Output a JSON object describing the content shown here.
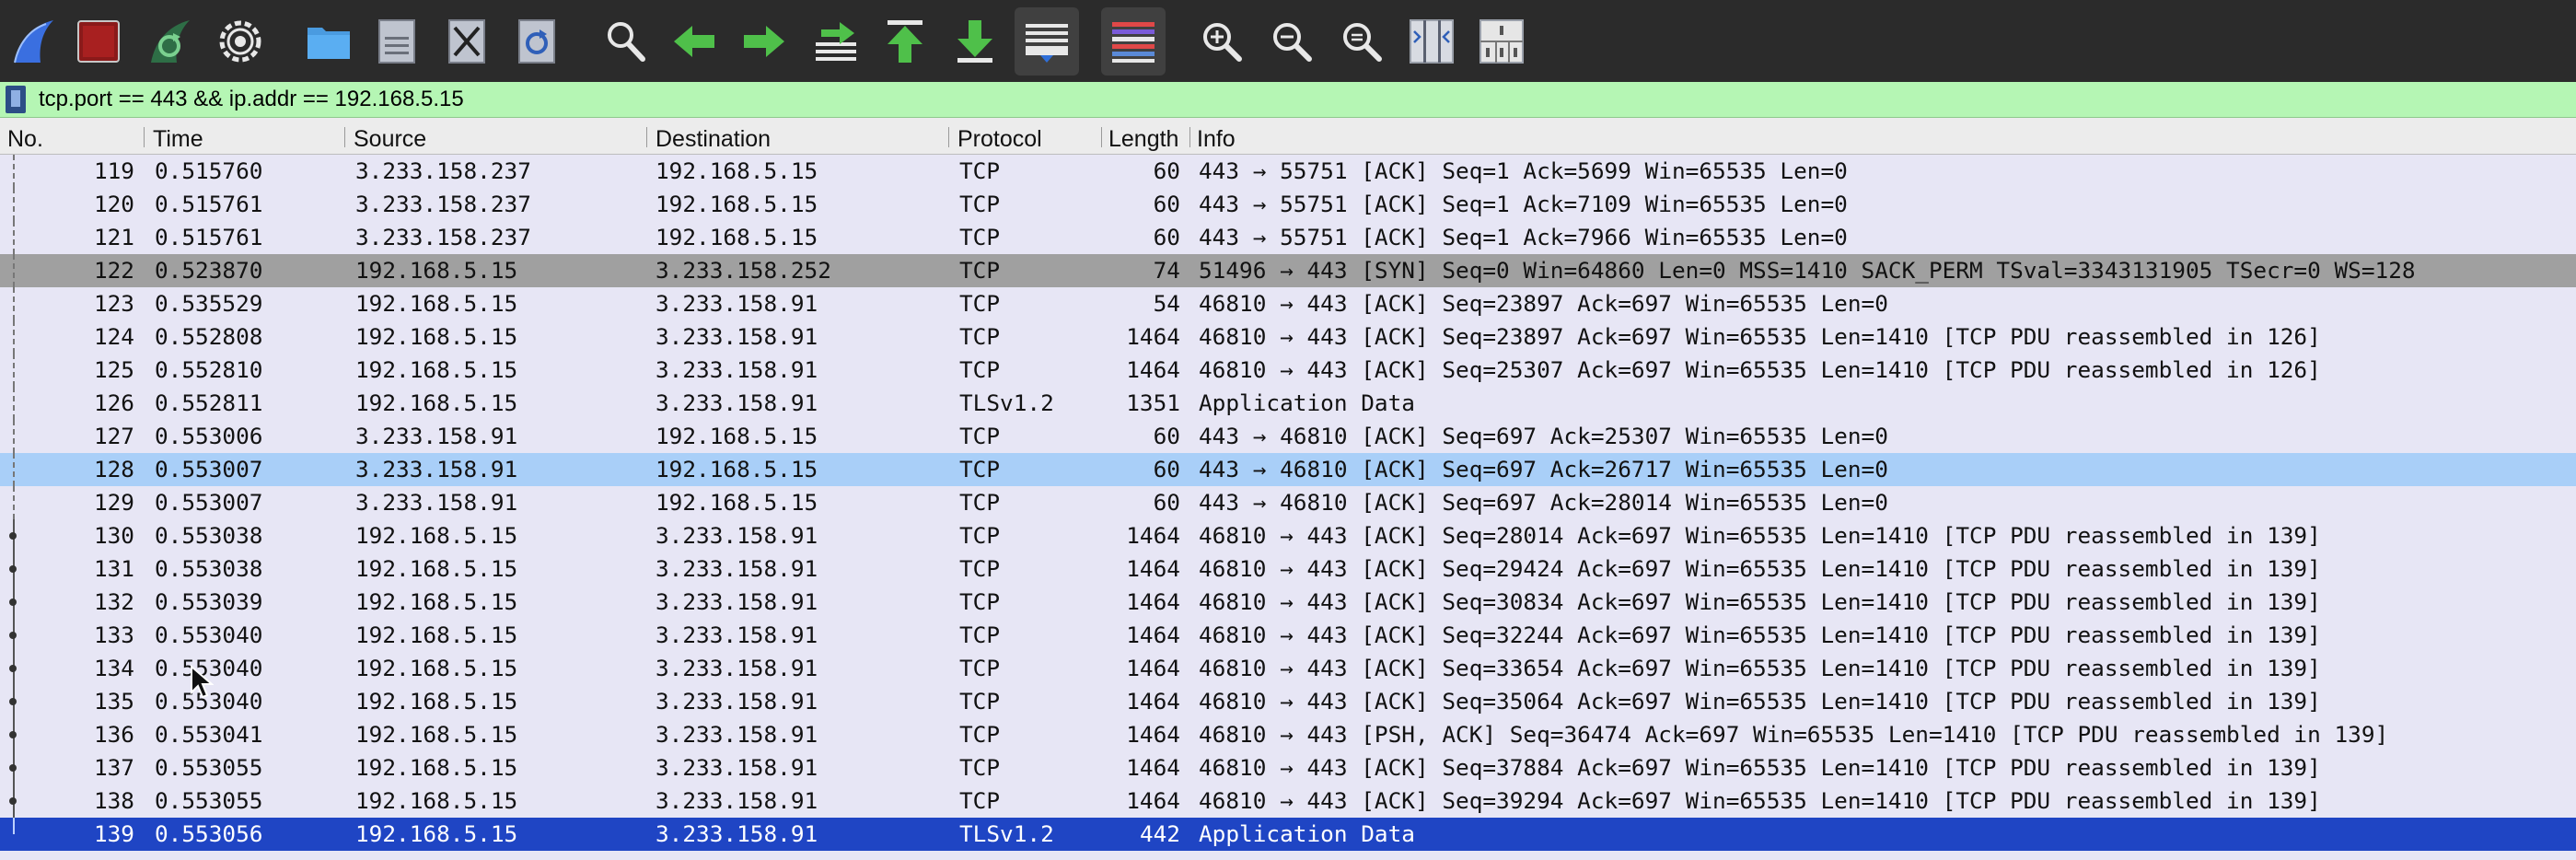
{
  "toolbar": {
    "buttons": [
      {
        "name": "start-capture-icon"
      },
      {
        "name": "stop-capture-icon"
      },
      {
        "name": "restart-capture-icon"
      },
      {
        "name": "capture-options-icon"
      },
      {
        "name": "open-file-icon"
      },
      {
        "name": "save-file-icon"
      },
      {
        "name": "close-file-icon"
      },
      {
        "name": "reload-file-icon"
      },
      {
        "name": "find-packet-icon"
      },
      {
        "name": "go-back-icon"
      },
      {
        "name": "go-forward-icon"
      },
      {
        "name": "go-to-packet-icon"
      },
      {
        "name": "go-first-packet-icon"
      },
      {
        "name": "go-last-packet-icon"
      },
      {
        "name": "auto-scroll-icon"
      },
      {
        "name": "colorize-icon"
      },
      {
        "name": "zoom-in-icon"
      },
      {
        "name": "zoom-out-icon"
      },
      {
        "name": "normal-size-icon"
      },
      {
        "name": "resize-columns-icon"
      },
      {
        "name": "packet-bytes-layout-icon"
      }
    ]
  },
  "filter": {
    "value": "tcp.port == 443 && ip.addr == 192.168.5.15"
  },
  "columns": {
    "no": "No.",
    "time": "Time",
    "source": "Source",
    "destination": "Destination",
    "protocol": "Protocol",
    "length": "Length",
    "info": "Info"
  },
  "packets": [
    {
      "no": "119",
      "time": "0.515760",
      "source": "3.233.158.237",
      "destination": "192.168.5.15",
      "protocol": "TCP",
      "length": "60",
      "info": "443 → 55751 [ACK] Seq=1 Ack=5699 Win=65535 Len=0"
    },
    {
      "no": "120",
      "time": "0.515761",
      "source": "3.233.158.237",
      "destination": "192.168.5.15",
      "protocol": "TCP",
      "length": "60",
      "info": "443 → 55751 [ACK] Seq=1 Ack=7109 Win=65535 Len=0"
    },
    {
      "no": "121",
      "time": "0.515761",
      "source": "3.233.158.237",
      "destination": "192.168.5.15",
      "protocol": "TCP",
      "length": "60",
      "info": "443 → 55751 [ACK] Seq=1 Ack=7966 Win=65535 Len=0"
    },
    {
      "no": "122",
      "time": "0.523870",
      "source": "192.168.5.15",
      "destination": "3.233.158.252",
      "protocol": "TCP",
      "length": "74",
      "info": "51496 → 443 [SYN] Seq=0 Win=64860 Len=0 MSS=1410 SACK_PERM TSval=3343131905 TSecr=0 WS=128"
    },
    {
      "no": "123",
      "time": "0.535529",
      "source": "192.168.5.15",
      "destination": "3.233.158.91",
      "protocol": "TCP",
      "length": "54",
      "info": "46810 → 443 [ACK] Seq=23897 Ack=697 Win=65535 Len=0"
    },
    {
      "no": "124",
      "time": "0.552808",
      "source": "192.168.5.15",
      "destination": "3.233.158.91",
      "protocol": "TCP",
      "length": "1464",
      "info": "46810 → 443 [ACK] Seq=23897 Ack=697 Win=65535 Len=1410 [TCP PDU reassembled in 126]"
    },
    {
      "no": "125",
      "time": "0.552810",
      "source": "192.168.5.15",
      "destination": "3.233.158.91",
      "protocol": "TCP",
      "length": "1464",
      "info": "46810 → 443 [ACK] Seq=25307 Ack=697 Win=65535 Len=1410 [TCP PDU reassembled in 126]"
    },
    {
      "no": "126",
      "time": "0.552811",
      "source": "192.168.5.15",
      "destination": "3.233.158.91",
      "protocol": "TLSv1.2",
      "length": "1351",
      "info": "Application Data"
    },
    {
      "no": "127",
      "time": "0.553006",
      "source": "3.233.158.91",
      "destination": "192.168.5.15",
      "protocol": "TCP",
      "length": "60",
      "info": "443 → 46810 [ACK] Seq=697 Ack=25307 Win=65535 Len=0"
    },
    {
      "no": "128",
      "time": "0.553007",
      "source": "3.233.158.91",
      "destination": "192.168.5.15",
      "protocol": "TCP",
      "length": "60",
      "info": "443 → 46810 [ACK] Seq=697 Ack=26717 Win=65535 Len=0"
    },
    {
      "no": "129",
      "time": "0.553007",
      "source": "3.233.158.91",
      "destination": "192.168.5.15",
      "protocol": "TCP",
      "length": "60",
      "info": "443 → 46810 [ACK] Seq=697 Ack=28014 Win=65535 Len=0"
    },
    {
      "no": "130",
      "time": "0.553038",
      "source": "192.168.5.15",
      "destination": "3.233.158.91",
      "protocol": "TCP",
      "length": "1464",
      "info": "46810 → 443 [ACK] Seq=28014 Ack=697 Win=65535 Len=1410 [TCP PDU reassembled in 139]"
    },
    {
      "no": "131",
      "time": "0.553038",
      "source": "192.168.5.15",
      "destination": "3.233.158.91",
      "protocol": "TCP",
      "length": "1464",
      "info": "46810 → 443 [ACK] Seq=29424 Ack=697 Win=65535 Len=1410 [TCP PDU reassembled in 139]"
    },
    {
      "no": "132",
      "time": "0.553039",
      "source": "192.168.5.15",
      "destination": "3.233.158.91",
      "protocol": "TCP",
      "length": "1464",
      "info": "46810 → 443 [ACK] Seq=30834 Ack=697 Win=65535 Len=1410 [TCP PDU reassembled in 139]"
    },
    {
      "no": "133",
      "time": "0.553040",
      "source": "192.168.5.15",
      "destination": "3.233.158.91",
      "protocol": "TCP",
      "length": "1464",
      "info": "46810 → 443 [ACK] Seq=32244 Ack=697 Win=65535 Len=1410 [TCP PDU reassembled in 139]"
    },
    {
      "no": "134",
      "time": "0.553040",
      "source": "192.168.5.15",
      "destination": "3.233.158.91",
      "protocol": "TCP",
      "length": "1464",
      "info": "46810 → 443 [ACK] Seq=33654 Ack=697 Win=65535 Len=1410 [TCP PDU reassembled in 139]"
    },
    {
      "no": "135",
      "time": "0.553040",
      "source": "192.168.5.15",
      "destination": "3.233.158.91",
      "protocol": "TCP",
      "length": "1464",
      "info": "46810 → 443 [ACK] Seq=35064 Ack=697 Win=65535 Len=1410 [TCP PDU reassembled in 139]"
    },
    {
      "no": "136",
      "time": "0.553041",
      "source": "192.168.5.15",
      "destination": "3.233.158.91",
      "protocol": "TCP",
      "length": "1464",
      "info": "46810 → 443 [PSH, ACK] Seq=36474 Ack=697 Win=65535 Len=1410 [TCP PDU reassembled in 139]"
    },
    {
      "no": "137",
      "time": "0.553055",
      "source": "192.168.5.15",
      "destination": "3.233.158.91",
      "protocol": "TCP",
      "length": "1464",
      "info": "46810 → 443 [ACK] Seq=37884 Ack=697 Win=65535 Len=1410 [TCP PDU reassembled in 139]"
    },
    {
      "no": "138",
      "time": "0.553055",
      "source": "192.168.5.15",
      "destination": "3.233.158.91",
      "protocol": "TCP",
      "length": "1464",
      "info": "46810 → 443 [ACK] Seq=39294 Ack=697 Win=65535 Len=1410 [TCP PDU reassembled in 139]"
    },
    {
      "no": "139",
      "time": "0.553056",
      "source": "192.168.5.15",
      "destination": "3.233.158.91",
      "protocol": "TLSv1.2",
      "length": "442",
      "info": "Application Data"
    }
  ],
  "colors": {
    "toolbar_bg": "#2b2b2b",
    "filter_bg": "#b5f6b4",
    "row_bg": "#e7e6f5",
    "syn_row_bg": "#a0a0a0",
    "highlight_row_bg": "#a9cff8",
    "selected_row_bg": "#1f45c4"
  }
}
